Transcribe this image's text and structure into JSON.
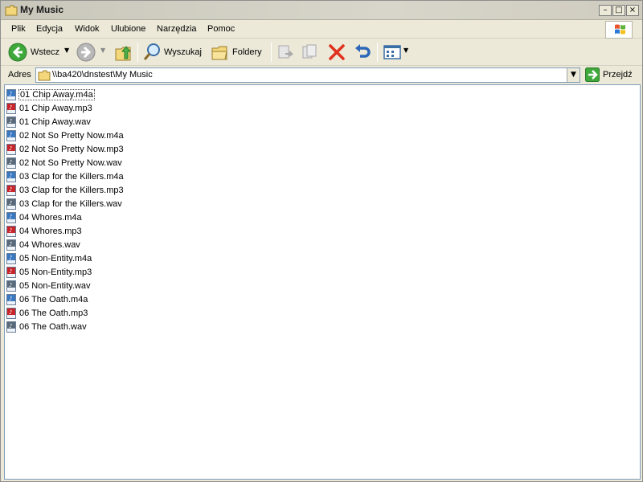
{
  "window": {
    "title": "My Music"
  },
  "menu": {
    "items": [
      "Plik",
      "Edycja",
      "Widok",
      "Ulubione",
      "Narzędzia",
      "Pomoc"
    ]
  },
  "toolbar": {
    "back_label": "Wstecz",
    "search_label": "Wyszukaj",
    "folders_label": "Foldery"
  },
  "address": {
    "label": "Adres",
    "value": "\\\\ba420\\dnstest\\My Music",
    "go_label": "Przejdź"
  },
  "files": [
    {
      "name": "01 Chip Away.m4a",
      "type": "m4a"
    },
    {
      "name": "01 Chip Away.mp3",
      "type": "mp3"
    },
    {
      "name": "01 Chip Away.wav",
      "type": "wav"
    },
    {
      "name": "02 Not So Pretty Now.m4a",
      "type": "m4a"
    },
    {
      "name": "02 Not So Pretty Now.mp3",
      "type": "mp3"
    },
    {
      "name": "02 Not So Pretty Now.wav",
      "type": "wav"
    },
    {
      "name": "03 Clap for the Killers.m4a",
      "type": "m4a"
    },
    {
      "name": "03 Clap for the Killers.mp3",
      "type": "mp3"
    },
    {
      "name": "03 Clap for the Killers.wav",
      "type": "wav"
    },
    {
      "name": "04 Whores.m4a",
      "type": "m4a"
    },
    {
      "name": "04 Whores.mp3",
      "type": "mp3"
    },
    {
      "name": "04 Whores.wav",
      "type": "wav"
    },
    {
      "name": "05 Non-Entity.m4a",
      "type": "m4a"
    },
    {
      "name": "05 Non-Entity.mp3",
      "type": "mp3"
    },
    {
      "name": "05 Non-Entity.wav",
      "type": "wav"
    },
    {
      "name": "06 The Oath.m4a",
      "type": "m4a"
    },
    {
      "name": "06 The Oath.mp3",
      "type": "mp3"
    },
    {
      "name": "06 The Oath.wav",
      "type": "wav"
    }
  ],
  "colors": {
    "m4a": "#3a78c2",
    "mp3": "#c8262b",
    "wav": "#5a6a7a"
  }
}
